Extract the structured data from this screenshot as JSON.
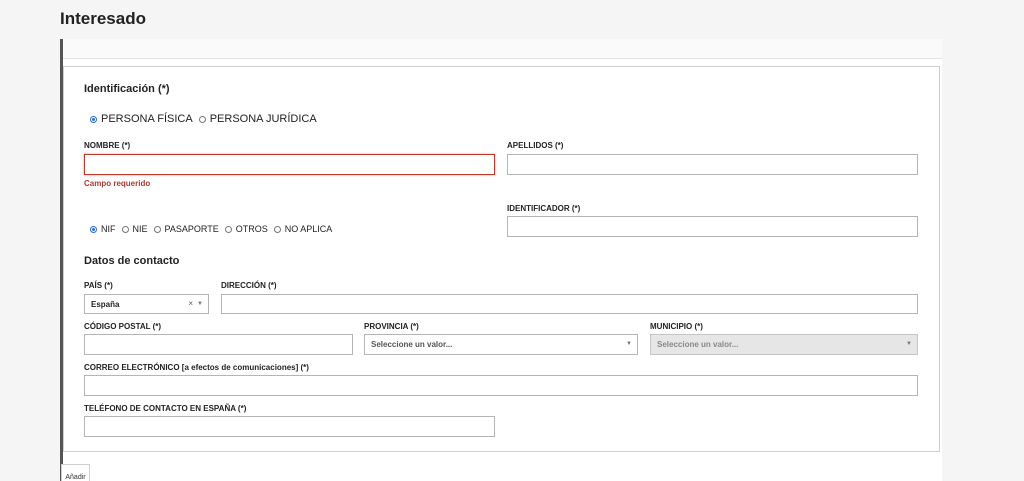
{
  "page": {
    "title": "Interesado"
  },
  "identificacion": {
    "title": "Identificación (*)",
    "persona_options": [
      {
        "label": "PERSONA FÍSICA",
        "selected": true
      },
      {
        "label": "PERSONA JURÍDICA",
        "selected": false
      }
    ],
    "nombre": {
      "label": "NOMBRE (*)",
      "value": "",
      "error": "Campo requerido"
    },
    "apellidos": {
      "label": "APELLIDOS (*)",
      "value": ""
    },
    "doc_options": [
      {
        "label": "NIF",
        "selected": true
      },
      {
        "label": "NIE",
        "selected": false
      },
      {
        "label": "PASAPORTE",
        "selected": false
      },
      {
        "label": "OTROS",
        "selected": false
      },
      {
        "label": "NO APLICA",
        "selected": false
      }
    ],
    "identificador": {
      "label": "IDENTIFICADOR (*)",
      "value": ""
    }
  },
  "contacto": {
    "title": "Datos de contacto",
    "pais": {
      "label": "PAÍS (*)",
      "value": "España",
      "clear": "×",
      "caret": "▼"
    },
    "direccion": {
      "label": "DIRECCIÓN (*)",
      "value": ""
    },
    "codigo_postal": {
      "label": "CÓDIGO POSTAL (*)",
      "value": ""
    },
    "provincia": {
      "label": "PROVINCIA (*)",
      "value": "Seleccione un valor...",
      "caret": "▼"
    },
    "municipio": {
      "label": "MUNICIPIO (*)",
      "value": "Seleccione un valor...",
      "caret": "▼",
      "disabled": true
    },
    "correo": {
      "label": "CORREO ELECTRÓNICO [a efectos de comunicaciones] (*)",
      "value": ""
    },
    "telefono": {
      "label": "TELÉFONO DE CONTACTO EN ESPAÑA (*)",
      "value": ""
    }
  },
  "actions": {
    "add_label": "Añadir"
  },
  "colors": {
    "accent": "#2a6ed8",
    "error": "#b03a2e",
    "border": "#b5b5b5"
  }
}
